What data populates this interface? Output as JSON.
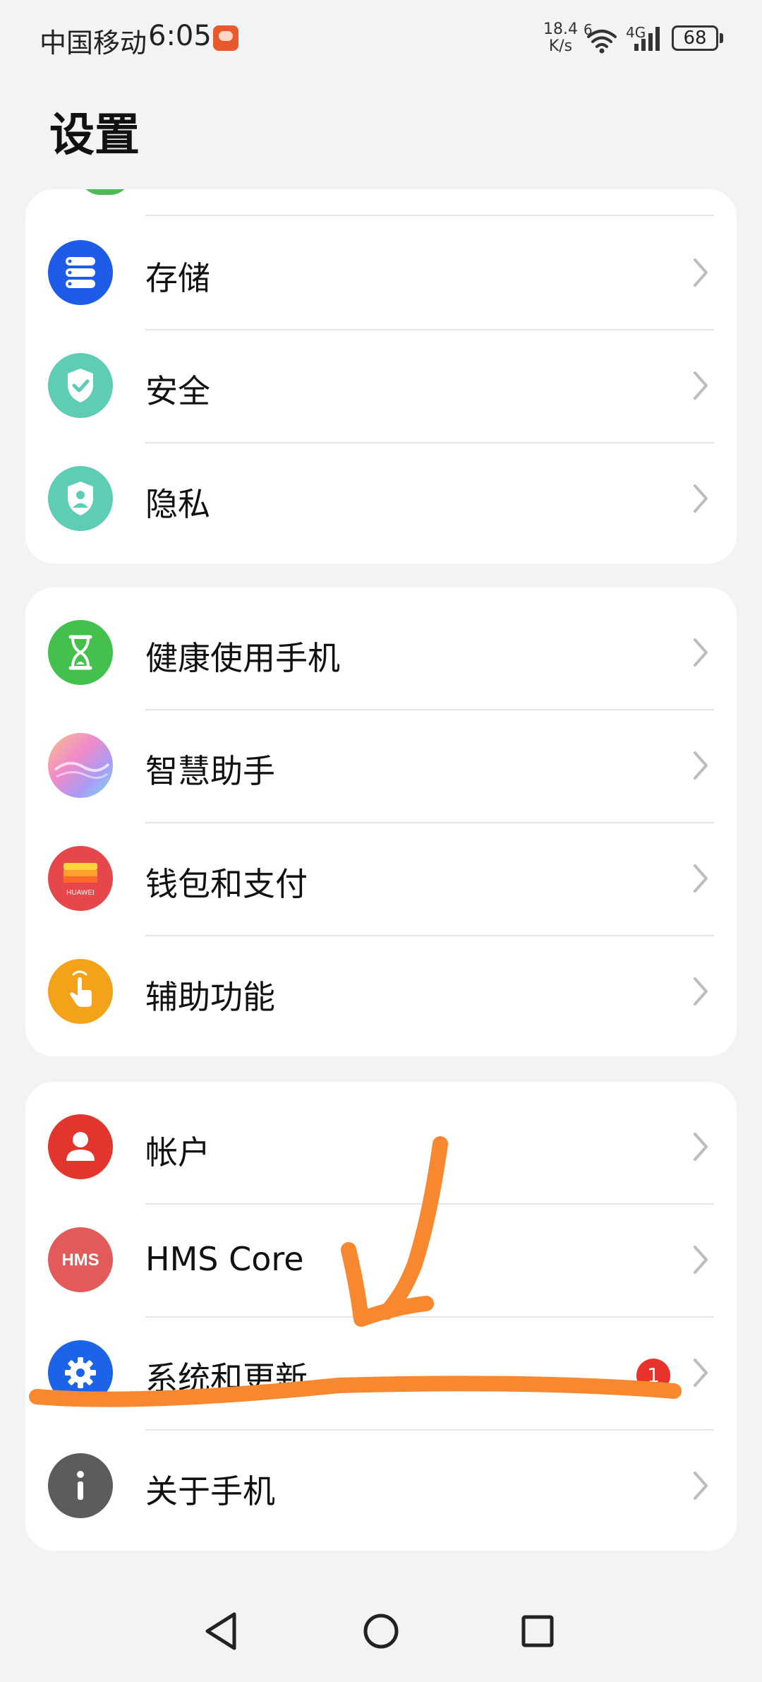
{
  "status_bar": {
    "carrier": "中国移动",
    "time": "6:05",
    "net_speed_value": "18.4",
    "net_speed_unit": "K/s",
    "wifi_label": "6",
    "signal_label": "4G",
    "battery": "68"
  },
  "page": {
    "title": "设置"
  },
  "groups": [
    {
      "items": [
        {
          "label": "存储",
          "icon": "storage-icon",
          "color": "#1e5be6"
        },
        {
          "label": "安全",
          "icon": "security-shield-icon",
          "color": "#5fcdb6"
        },
        {
          "label": "隐私",
          "icon": "privacy-shield-icon",
          "color": "#5fcdb6"
        }
      ]
    },
    {
      "items": [
        {
          "label": "健康使用手机",
          "icon": "hourglass-icon",
          "color": "#44c14c"
        },
        {
          "label": "智慧助手",
          "icon": "smart-assistant-icon",
          "color": "#e6a8e0"
        },
        {
          "label": "钱包和支付",
          "icon": "wallet-icon",
          "color": "#e5474a",
          "icon_text": "HUAWEI"
        },
        {
          "label": "辅助功能",
          "icon": "accessibility-hand-icon",
          "color": "#f5a21b"
        }
      ]
    },
    {
      "items": [
        {
          "label": "帐户",
          "icon": "account-icon",
          "color": "#e2352d"
        },
        {
          "label": "HMS Core",
          "icon": "hms-icon",
          "color": "#e25a5a",
          "icon_text": "HMS"
        },
        {
          "label": "系统和更新",
          "icon": "system-gear-icon",
          "color": "#1c63e8",
          "badge": "1"
        },
        {
          "label": "关于手机",
          "icon": "info-icon",
          "color": "#5c5c5c"
        }
      ]
    }
  ],
  "annotation_color": "#f7882f"
}
